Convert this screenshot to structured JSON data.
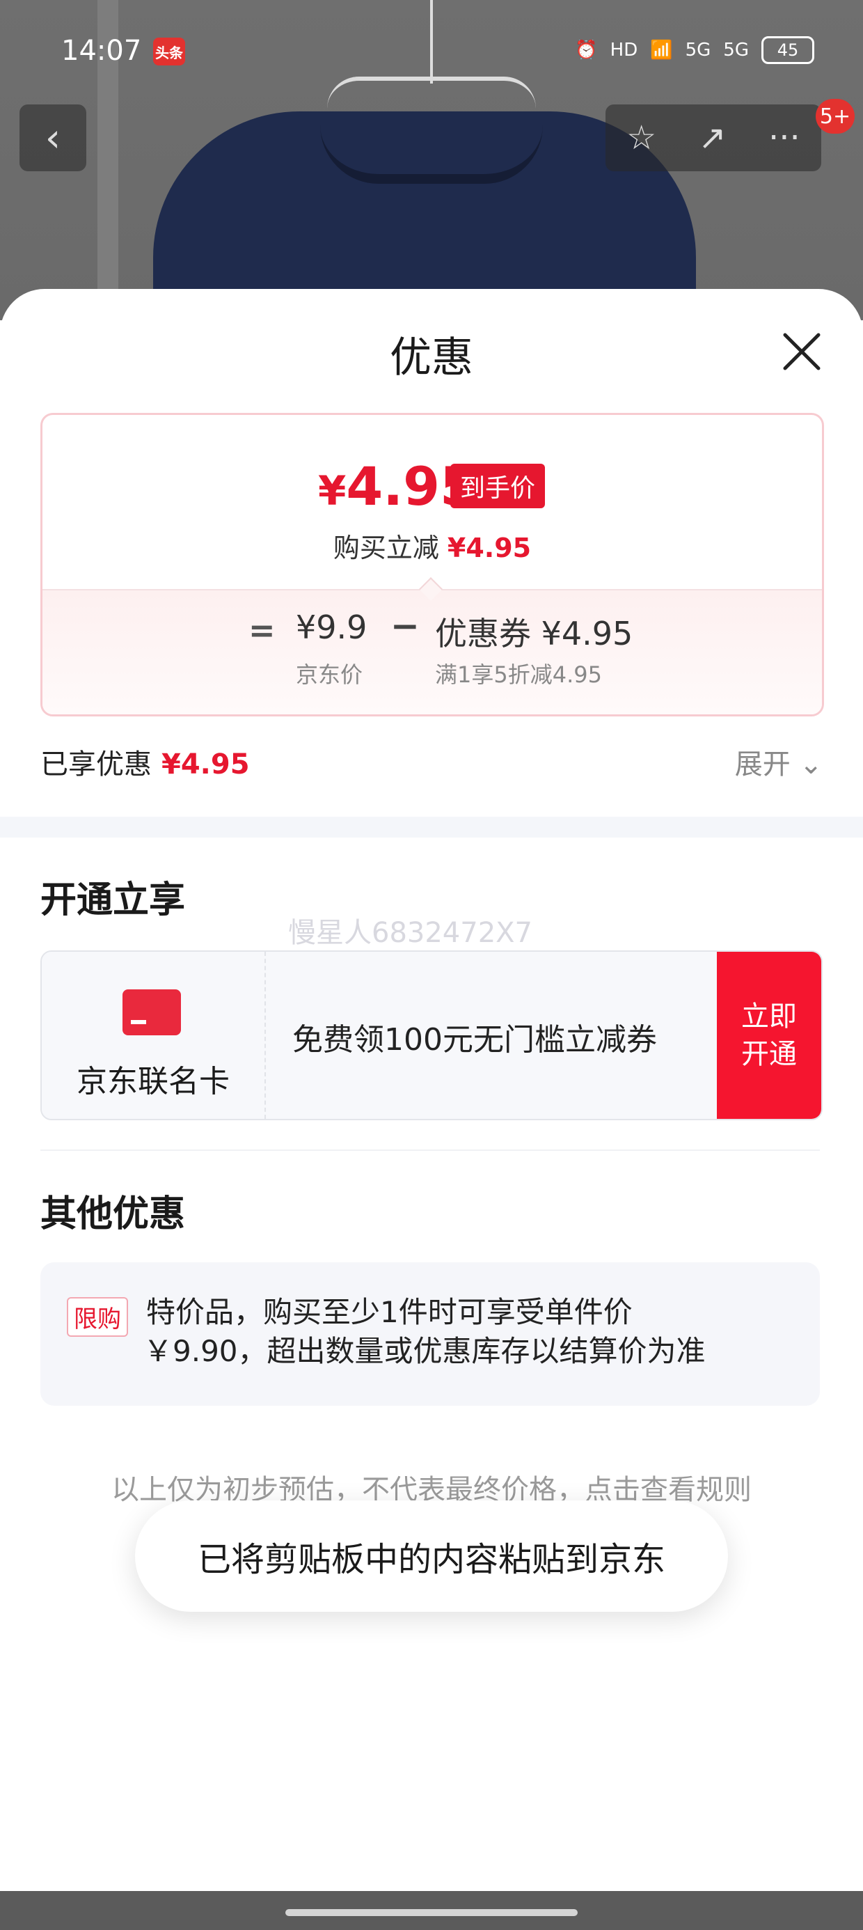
{
  "status_bar": {
    "time": "14:07",
    "app_badge": "头条",
    "hd_label": "HD",
    "network_1": "5G",
    "network_2": "5G",
    "battery": "45"
  },
  "nav": {
    "notification_count": "5+"
  },
  "sheet": {
    "title": "优惠"
  },
  "price_card": {
    "currency": "¥",
    "final_price": "4.95",
    "final_price_tag": "到手价",
    "reduce_label": "购买立减",
    "reduce_amount": "¥4.95",
    "equals": "=",
    "jd_price": "¥9.9",
    "jd_price_label": "京东价",
    "minus": "−",
    "coupon": "优惠券 ¥4.95",
    "coupon_detail": "满1享5折减4.95"
  },
  "summary": {
    "enjoyed_label": "已享优惠",
    "enjoyed_amount": "¥4.95",
    "expand_label": "展开"
  },
  "open_section": {
    "title": "开通立享",
    "watermark": "慢星人6832472X7",
    "card_name": "京东联名卡",
    "card_desc": "免费领100元无门槛立减券",
    "btn_line1": "立即",
    "btn_line2": "开通"
  },
  "other_section": {
    "title": "其他优惠",
    "limit_tag": "限购",
    "limit_line1": "特价品，购买至少1件时可享受单件价",
    "limit_line2": "￥9.90，超出数量或优惠库存以结算价为准"
  },
  "disclaimer": "以上仅为初步预估，不代表最终价格，点击查看规则",
  "toast": "已将剪贴板中的内容粘贴到京东",
  "colors": {
    "accent_red": "#e6172f",
    "button_red": "#f5152f"
  }
}
